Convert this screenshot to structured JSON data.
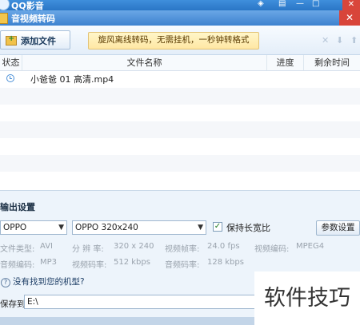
{
  "app": {
    "title": "QQ影音"
  },
  "dialog": {
    "title": "音视频转码"
  },
  "toolbar": {
    "add_file_label": "添加文件",
    "tip": "旋风离线转码，无需挂机，一秒钟转格式"
  },
  "file_list": {
    "columns": [
      "状态",
      "文件名称",
      "进度",
      "剩余时间"
    ],
    "rows": [
      {
        "status_icon": "clock-icon",
        "name": "小爸爸 01 高清.mp4",
        "progress": "",
        "remaining": ""
      }
    ]
  },
  "output": {
    "heading": "输出设置",
    "device": "OPPO",
    "profile": "OPPO 320x240",
    "keep_ratio": {
      "label": "保持长宽比",
      "checked": true
    },
    "params_button": "参数设置",
    "specs": {
      "file_type_label": "文件类型:",
      "file_type": "AVI",
      "resolution_label": "分 辨 率:",
      "resolution": "320 x 240",
      "fps_label": "视频帧率:",
      "fps": "24.0 fps",
      "vcodec_label": "视频编码:",
      "vcodec": "MPEG4",
      "acodec_label": "音频编码:",
      "acodec": "MP3",
      "vbitrate_label": "视频码率:",
      "vbitrate": "512 kbps",
      "abitrate_label": "音频码率:",
      "abitrate": "128 kbps"
    },
    "help_link": "没有找到您的机型?",
    "save_to_label": "保存到:",
    "save_to_value": "E:\\"
  },
  "watermark": "软件技巧"
}
